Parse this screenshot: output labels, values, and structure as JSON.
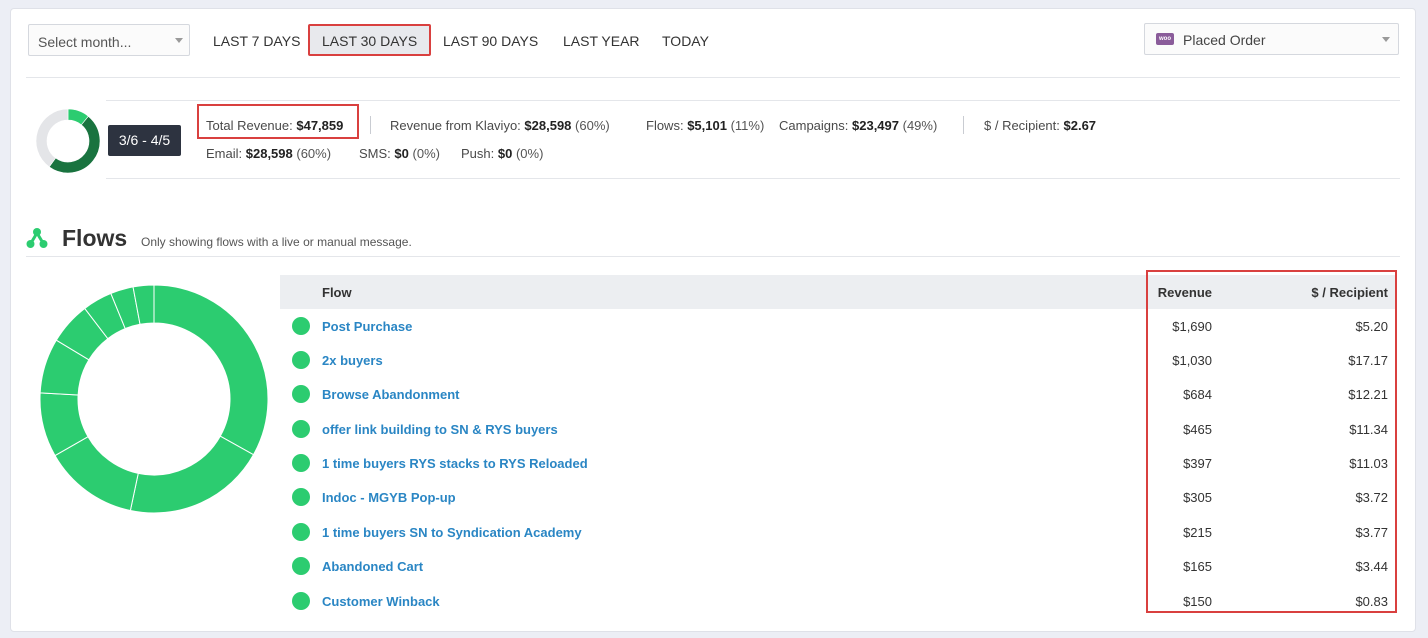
{
  "toolbar": {
    "month_placeholder": "Select month...",
    "ranges": [
      "LAST 7 DAYS",
      "LAST 30 DAYS",
      "LAST 90 DAYS",
      "LAST YEAR",
      "TODAY"
    ],
    "active_range": "LAST 30 DAYS",
    "metric_logo_text": "woo",
    "metric_selected": "Placed Order"
  },
  "summary": {
    "date_range": "3/6 - 4/5",
    "total_revenue_label": "Total Revenue:",
    "total_revenue": "$47,859",
    "klaviyo_label": "Revenue from Klaviyo:",
    "klaviyo_value": "$28,598",
    "klaviyo_pct": "(60%)",
    "flows_label": "Flows:",
    "flows_value": "$5,101",
    "flows_pct": "(11%)",
    "campaigns_label": "Campaigns:",
    "campaigns_value": "$23,497",
    "campaigns_pct": "(49%)",
    "recipient_label": "$ / Recipient:",
    "recipient_value": "$2.67",
    "email_label": "Email:",
    "email_value": "$28,598",
    "email_pct": "(60%)",
    "sms_label": "SMS:",
    "sms_value": "$0",
    "sms_pct": "(0%)",
    "push_label": "Push:",
    "push_value": "$0",
    "push_pct": "(0%)",
    "klaviyo_share": 0.6,
    "flows_share": 0.11
  },
  "flows": {
    "title": "Flows",
    "subtitle": "Only showing flows with a live or manual message.",
    "col_flow": "Flow",
    "col_revenue": "Revenue",
    "col_per_recipient": "$ / Recipient",
    "rows": [
      {
        "name": "Post Purchase",
        "revenue": "$1,690",
        "per_recipient": "$5.20",
        "value": 1690
      },
      {
        "name": "2x buyers",
        "revenue": "$1,030",
        "per_recipient": "$17.17",
        "value": 1030
      },
      {
        "name": "Browse Abandonment",
        "revenue": "$684",
        "per_recipient": "$12.21",
        "value": 684
      },
      {
        "name": "offer link building to SN & RYS buyers",
        "revenue": "$465",
        "per_recipient": "$11.34",
        "value": 465
      },
      {
        "name": "1 time buyers RYS stacks to RYS Reloaded",
        "revenue": "$397",
        "per_recipient": "$11.03",
        "value": 397
      },
      {
        "name": "Indoc - MGYB Pop-up",
        "revenue": "$305",
        "per_recipient": "$3.72",
        "value": 305
      },
      {
        "name": "1 time buyers SN to Syndication Academy",
        "revenue": "$215",
        "per_recipient": "$3.77",
        "value": 215
      },
      {
        "name": "Abandoned Cart",
        "revenue": "$165",
        "per_recipient": "$3.44",
        "value": 165
      },
      {
        "name": "Customer Winback",
        "revenue": "$150",
        "per_recipient": "$0.83",
        "value": 150
      }
    ]
  },
  "colors": {
    "accent_green": "#2ccc70",
    "dark_green": "#19733f",
    "highlight_red": "#d9403f",
    "link_blue": "#2a86c4"
  }
}
